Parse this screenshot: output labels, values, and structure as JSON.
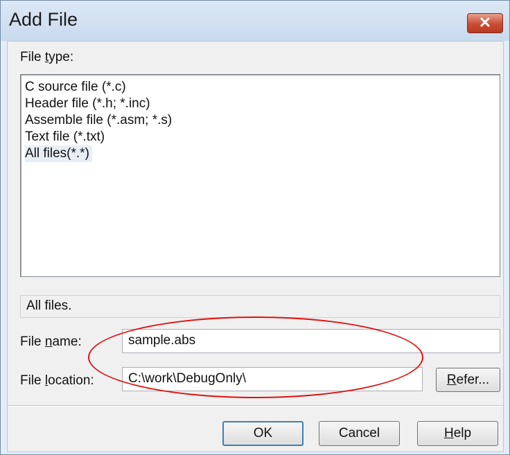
{
  "window": {
    "title": "Add File",
    "close_glyph": "✕"
  },
  "file_type": {
    "label_pre": "File ",
    "label_accel": "t",
    "label_post": "ype:",
    "items": [
      {
        "label": "C source file (*.c)",
        "selected": false
      },
      {
        "label": "Header file (*.h; *.inc)",
        "selected": false
      },
      {
        "label": "Assemble file (*.asm; *.s)",
        "selected": false
      },
      {
        "label": "Text file (*.txt)",
        "selected": false
      },
      {
        "label": "All files(*.*)",
        "selected": true
      }
    ],
    "description": "All files."
  },
  "file_name": {
    "label_pre": "File ",
    "label_accel": "n",
    "label_post": "ame:",
    "value": "sample.abs"
  },
  "file_location": {
    "label_pre": "File ",
    "label_accel": "l",
    "label_post": "ocation:",
    "value": "C:\\work\\DebugOnly\\"
  },
  "buttons": {
    "refer_accel": "R",
    "refer_rest": "efer...",
    "ok": "OK",
    "cancel": "Cancel",
    "help_accel": "H",
    "help_rest": "elp"
  },
  "colors": {
    "annotation": "#e01010",
    "close_button": "#c94c33",
    "default_button_border": "#3c7fb1"
  }
}
